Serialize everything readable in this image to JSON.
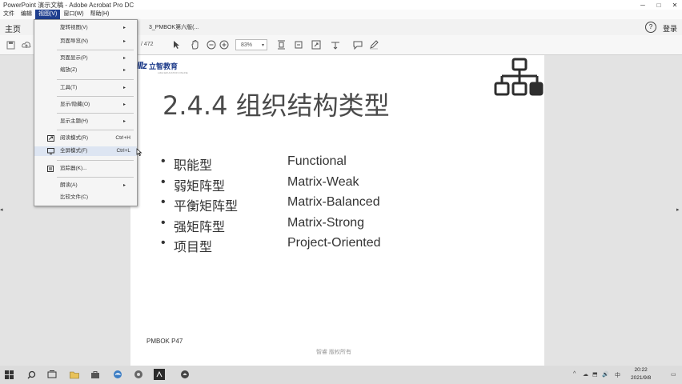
{
  "window": {
    "title": "PowerPoint 演示文稿 - Adobe Acrobat Pro DC",
    "controls": {
      "minimize": "─",
      "maximize": "□",
      "close": "✕"
    }
  },
  "menubar": {
    "items": [
      {
        "label": "文件"
      },
      {
        "label": "编辑"
      },
      {
        "label": "视图(V)",
        "active": true
      },
      {
        "label": "窗口(W)"
      },
      {
        "label": "帮助(H)"
      }
    ]
  },
  "tabs": {
    "home": "主页",
    "document": "3_PMBOK第六版(...",
    "help": "?",
    "login": "登录"
  },
  "toolbar": {
    "page_total": "/ 472",
    "zoom": "83%",
    "icons": [
      "save-icon",
      "upload-icon",
      "print-icon",
      "select-arrow-icon",
      "hand-icon",
      "zoom-out-icon",
      "zoom-in-icon",
      "fit-page-icon",
      "rotate-icon",
      "fullscreen-icon",
      "scroll-icon",
      "comment-icon",
      "pen-icon"
    ]
  },
  "view_menu": {
    "items": [
      {
        "label": "旋转视图(V)",
        "arrow": "▸"
      },
      {
        "label": "页面导览(N)",
        "arrow": "▸"
      },
      {
        "label": "页面显示(P)",
        "arrow": "▸"
      },
      {
        "label": "缩放(Z)",
        "arrow": "▸"
      },
      {
        "label": "工具(T)",
        "arrow": "▸"
      },
      {
        "label": "显示/隐藏(O)",
        "arrow": "▸"
      },
      {
        "label": "显示主题(H)",
        "arrow": "▸"
      },
      {
        "label": "阅读模式(R)",
        "shortcut": "Ctrl+H"
      },
      {
        "label": "全屏模式(F)",
        "shortcut": "Ctrl+L"
      },
      {
        "label": "追踪器(K)..."
      },
      {
        "label": "朗读(A)",
        "arrow": "▸"
      },
      {
        "label": "比较文件(C)"
      }
    ]
  },
  "slide": {
    "logo": {
      "mark": "lllz",
      "name": "立智教育",
      "tagline": "LIZHI EDUCATION ONLINE"
    },
    "title": "2.4.4 组织结构类型",
    "types": [
      {
        "cn": "职能型",
        "en": "Functional"
      },
      {
        "cn": "弱矩阵型",
        "en": "Matrix-Weak"
      },
      {
        "cn": "平衡矩阵型",
        "en": "Matrix-Balanced"
      },
      {
        "cn": "强矩阵型",
        "en": "Matrix-Strong"
      },
      {
        "cn": "项目型",
        "en": "Project-Oriented"
      }
    ],
    "bullet": "•",
    "footer": "PMBOK P47",
    "watermark": "智睿 版权所有"
  },
  "taskbar": {
    "time": "20:22",
    "date": "2021/9/8",
    "icons": [
      "windows-start-icon",
      "search-icon",
      "task-view-icon",
      "file-explorer-icon",
      "store-icon",
      "edge-icon",
      "chrome-icon",
      "media-icon",
      "acrobat-icon",
      "app-icon"
    ],
    "tray": [
      "^",
      "☁",
      "⬒",
      "🔊",
      "中"
    ]
  },
  "colors": {
    "accent": "#1d3b8a",
    "menu_highlight": "#1f3f8f",
    "page_bg": "#ffffff",
    "viewer_bg": "#e3e3e3"
  }
}
